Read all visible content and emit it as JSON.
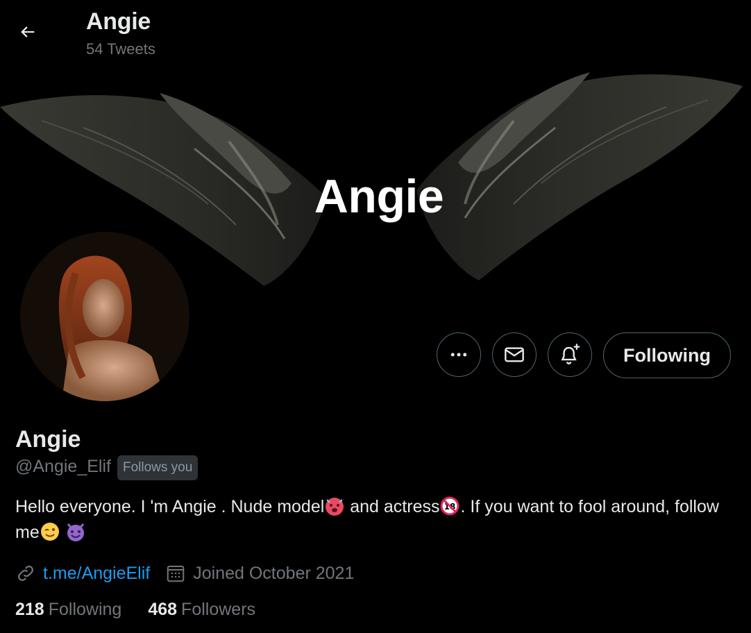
{
  "header": {
    "title": "Angie",
    "tweet_count": "54 Tweets",
    "back_icon": "arrow-left-icon"
  },
  "banner": {
    "text": "Angie",
    "image": "black-wings-banner"
  },
  "profile": {
    "avatar": "profile-photo",
    "display_name": "Angie",
    "handle": "@Angie_Elif",
    "follows_you": "Follows you",
    "bio_part1": "Hello everyone. I 'm Angie . Nude model",
    "bio_part2": " and actress",
    "bio_part3": ". If you want to fool around, follow me",
    "bio_emojis": [
      "hot-face-emoji",
      "no-under-18-emoji",
      "winking-face-emoji",
      "smiling-devil-emoji"
    ],
    "link": "t.me/AngieElif",
    "joined": "Joined October 2021",
    "following_count": "218",
    "following_label": "Following",
    "followers_count": "468",
    "followers_label": "Followers"
  },
  "actions": {
    "more_icon": "more-dots-icon",
    "message_icon": "envelope-icon",
    "notify_icon": "bell-plus-icon",
    "follow_label": "Following"
  },
  "colors": {
    "background": "#000000",
    "text": "#e7e9ea",
    "muted": "#71767b",
    "link": "#1d9bf0",
    "border": "#536471"
  }
}
